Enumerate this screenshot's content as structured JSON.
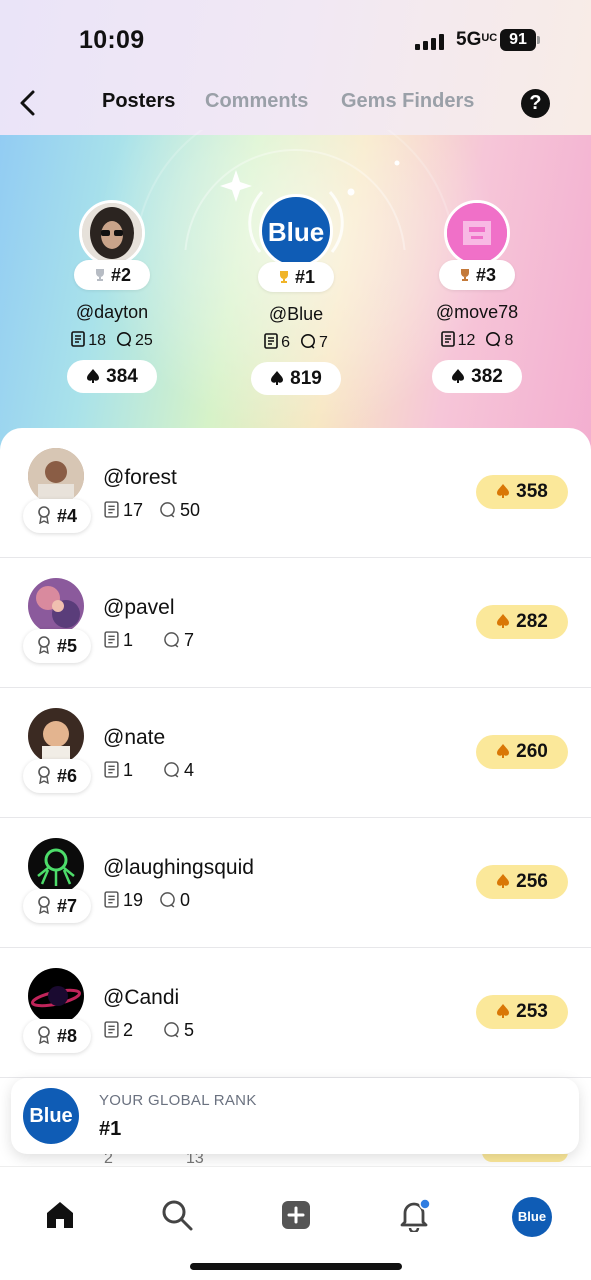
{
  "status": {
    "time": "10:09",
    "network": "5G",
    "battery": "91"
  },
  "nav": {
    "tabs": [
      {
        "label": "Posters",
        "active": true
      },
      {
        "label": "Comments",
        "active": false
      },
      {
        "label": "Gems Finders",
        "active": false
      }
    ],
    "help_label": "?"
  },
  "podium": [
    {
      "rank": "#2",
      "handle": "@dayton",
      "posts": "18",
      "comments": "25",
      "score": "384",
      "avatar": "photo"
    },
    {
      "rank": "#1",
      "handle": "@Blue",
      "posts": "6",
      "comments": "7",
      "score": "819",
      "avatar_text": "Blue"
    },
    {
      "rank": "#3",
      "handle": "@move78",
      "posts": "12",
      "comments": "8",
      "score": "382",
      "avatar": "pixel"
    }
  ],
  "list": [
    {
      "rank": "#4",
      "handle": "@forest",
      "posts": "17",
      "comments": "50",
      "score": "358"
    },
    {
      "rank": "#5",
      "handle": "@pavel",
      "posts": "1",
      "comments": "7",
      "score": "282"
    },
    {
      "rank": "#6",
      "handle": "@nate",
      "posts": "1",
      "comments": "4",
      "score": "260"
    },
    {
      "rank": "#7",
      "handle": "@laughingsquid",
      "posts": "19",
      "comments": "0",
      "score": "256"
    },
    {
      "rank": "#8",
      "handle": "@Candi",
      "posts": "2",
      "comments": "5",
      "score": "253"
    }
  ],
  "peek_row": {
    "posts": "2",
    "comments": "13"
  },
  "your_rank": {
    "avatar_text": "Blue",
    "label": "YOUR GLOBAL RANK",
    "value": "#1"
  },
  "tabbar": {
    "avatar_text": "Blue"
  },
  "colors": {
    "accent": "#0f5cb5",
    "score_bg": "#fbe89a",
    "leaf": "#d97706"
  }
}
